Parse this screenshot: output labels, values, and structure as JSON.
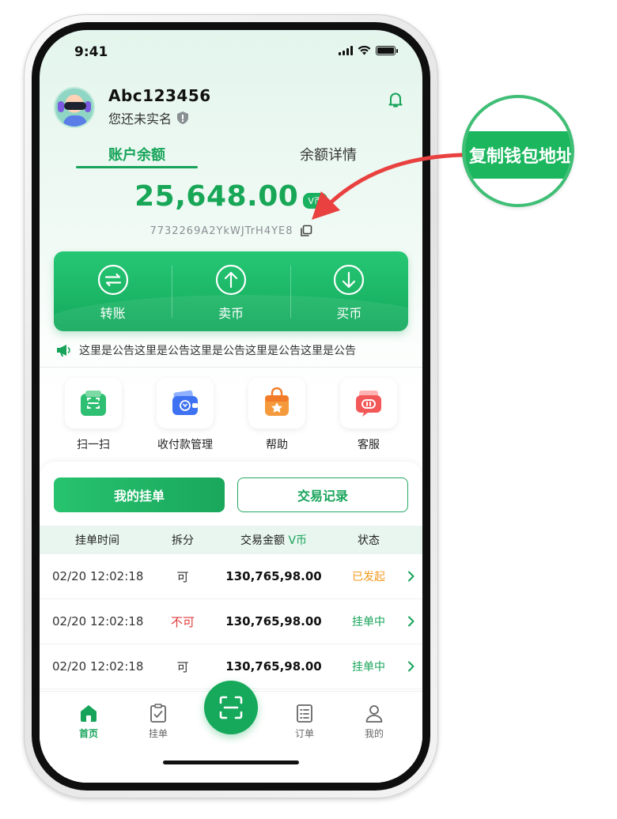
{
  "status_bar": {
    "time": "9:41"
  },
  "user": {
    "name": "Abc123456",
    "verify_text": "您还未实名"
  },
  "balance_tabs": {
    "active": "账户余额",
    "inactive": "余额详情"
  },
  "balance": {
    "amount": "25,648.00",
    "unit": "V币",
    "address": "7732269A2YkWJTrH4YE8"
  },
  "actions": [
    {
      "label": "转账",
      "icon": "transfer-icon"
    },
    {
      "label": "卖币",
      "icon": "arrow-up-circle-icon"
    },
    {
      "label": "买币",
      "icon": "arrow-down-circle-icon"
    }
  ],
  "notice": {
    "text": "这里是公告这里是公告这里是公告这里是公告这里是公告"
  },
  "menu": [
    {
      "label": "扫一扫",
      "icon": "scan-icon"
    },
    {
      "label": "收付款管理",
      "icon": "wallet-icon"
    },
    {
      "label": "帮助",
      "icon": "help-bag-icon"
    },
    {
      "label": "客服",
      "icon": "customer-service-icon"
    }
  ],
  "orders": {
    "tab_active": "我的挂单",
    "tab_inactive": "交易记录",
    "headers": {
      "time": "挂单时间",
      "split": "拆分",
      "amount": "交易金额",
      "amount_unit": "V币",
      "status": "状态"
    },
    "rows": [
      {
        "time": "02/20 12:02:18",
        "split": "可",
        "amount": "130,765,98.00",
        "status": "已发起"
      },
      {
        "time": "02/20 12:02:18",
        "split": "不可",
        "amount": "130,765,98.00",
        "status": "挂单中"
      },
      {
        "time": "02/20 12:02:18",
        "split": "可",
        "amount": "130,765,98.00",
        "status": "挂单中"
      }
    ]
  },
  "tabbar": {
    "home": "首页",
    "orders_list": "挂单",
    "order": "订单",
    "mine": "我的"
  },
  "callout": {
    "text": "复制钱包地址"
  },
  "colors": {
    "primary": "#17a45a",
    "status_started": "#f39a1e",
    "split_no": "#e23b3b",
    "arrow": "#e8413f"
  }
}
